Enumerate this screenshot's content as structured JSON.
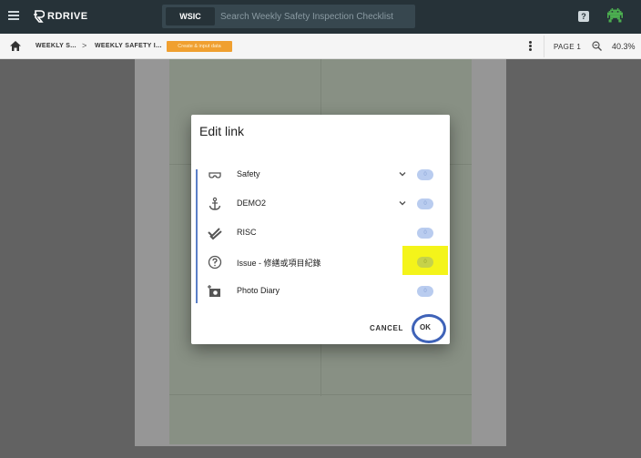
{
  "topbar": {
    "logo_text": "RDRIVE",
    "search_chip": "WSIC",
    "search_placeholder": "Search Weekly Safety Inspection Checklist",
    "help_icon": "help-box-icon",
    "avatar_icon": "space-invader-icon"
  },
  "breadcrumb": {
    "item1": "WEEKLY S...",
    "separator": ">",
    "item2": "WEEKLY SAFETY I...",
    "create_button": "Create & input data",
    "page_label": "PAGE 1",
    "zoom": "40.3%"
  },
  "dialog": {
    "title": "Edit link",
    "items": [
      {
        "label": "Safety",
        "icon": "glasses-icon",
        "has_dropdown": true,
        "toggle": "0"
      },
      {
        "label": "DEMO2",
        "icon": "anchor-icon",
        "has_dropdown": true,
        "toggle": "0"
      },
      {
        "label": "RISC",
        "icon": "double-check-icon",
        "has_dropdown": false,
        "toggle": "0"
      },
      {
        "label": "Issue - 修繕或項目紀錄",
        "icon": "help-circle-icon",
        "has_dropdown": false,
        "toggle": "0"
      },
      {
        "label": "Photo Diary",
        "icon": "add-photo-icon",
        "has_dropdown": false,
        "toggle": "0"
      }
    ],
    "cancel_label": "CANCEL",
    "ok_label": "OK"
  },
  "colors": {
    "topbar": "#263238",
    "accent_blue": "#3f63b8",
    "create_button": "#f0a030",
    "highlight": "#f4f41a",
    "toggle": "#b9ccef"
  }
}
